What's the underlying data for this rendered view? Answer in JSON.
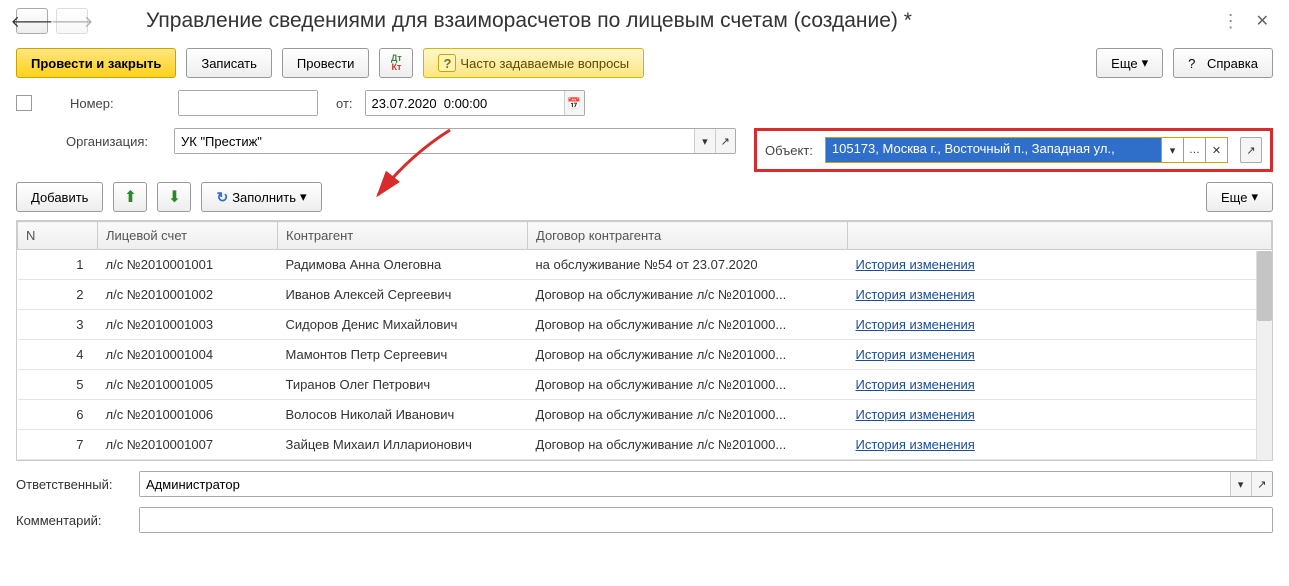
{
  "header": {
    "title": "Управление сведениями для взаиморасчетов по лицевым счетам (создание) *"
  },
  "toolbar": {
    "post_close": "Провести и закрыть",
    "save": "Записать",
    "post": "Провести",
    "faq": "Часто задаваемые вопросы",
    "more": "Еще",
    "help": "Справка",
    "help_q": "?"
  },
  "form": {
    "number_label": "Номер:",
    "number_value": "",
    "date_label": "от:",
    "date_value": "23.07.2020  0:00:00",
    "org_label": "Организация:",
    "org_value": "УК \"Престиж\"",
    "object_label": "Объект:",
    "object_value": "105173, Москва г., Восточный п., Западная ул.,"
  },
  "table_toolbar": {
    "add": "Добавить",
    "fill": "Заполнить",
    "more": "Еще"
  },
  "table": {
    "cols": {
      "n": "N",
      "account": "Лицевой счет",
      "counterparty": "Контрагент",
      "contract": "Договор контрагента",
      "history": ""
    },
    "history_link": "История изменения",
    "rows": [
      {
        "n": "1",
        "account": "л/с №2010001001",
        "counterparty": "Радимова Анна Олеговна",
        "contract": "на обслуживание №54 от 23.07.2020"
      },
      {
        "n": "2",
        "account": "л/с №2010001002",
        "counterparty": "Иванов Алексей Сергеевич",
        "contract": "Договор на обслуживание л/с №201000..."
      },
      {
        "n": "3",
        "account": "л/с №2010001003",
        "counterparty": "Сидоров Денис Михайлович",
        "contract": "Договор на обслуживание л/с №201000..."
      },
      {
        "n": "4",
        "account": "л/с №2010001004",
        "counterparty": "Мамонтов Петр Сергеевич",
        "contract": "Договор на обслуживание л/с №201000..."
      },
      {
        "n": "5",
        "account": "л/с №2010001005",
        "counterparty": "Тиранов Олег Петрович",
        "contract": "Договор на обслуживание л/с №201000..."
      },
      {
        "n": "6",
        "account": "л/с №2010001006",
        "counterparty": "Волосов Николай Иванович",
        "contract": "Договор на обслуживание л/с №201000..."
      },
      {
        "n": "7",
        "account": "л/с №2010001007",
        "counterparty": "Зайцев Михаил Илларионович",
        "contract": "Договор на обслуживание л/с №201000..."
      }
    ]
  },
  "footer": {
    "responsible_label": "Ответственный:",
    "responsible_value": "Администратор",
    "comment_label": "Комментарий:",
    "comment_value": ""
  }
}
